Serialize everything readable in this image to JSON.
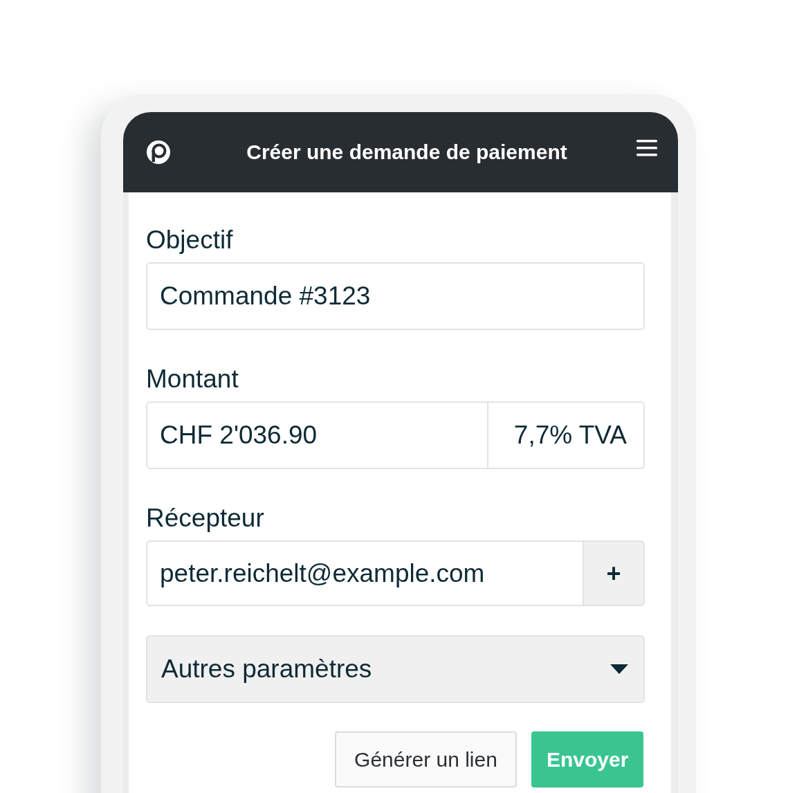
{
  "header": {
    "title": "Créer une demande de paiement"
  },
  "fields": [
    {
      "kind": "text",
      "label": "Objectif",
      "value": "Commande #3123"
    },
    {
      "kind": "amount",
      "label": "Montant",
      "value": "CHF 2'036.90",
      "addon": "7,7% TVA"
    },
    {
      "kind": "recipient",
      "label": "Récepteur",
      "value": "peter.reichelt@example.com",
      "addon": "+"
    }
  ],
  "more_settings": {
    "label": "Autres paramètres",
    "expanded": false
  },
  "buttons": [
    {
      "kind": "secondary",
      "label": "Générer un lien"
    },
    {
      "kind": "primary",
      "label": "Envoyer"
    }
  ]
}
